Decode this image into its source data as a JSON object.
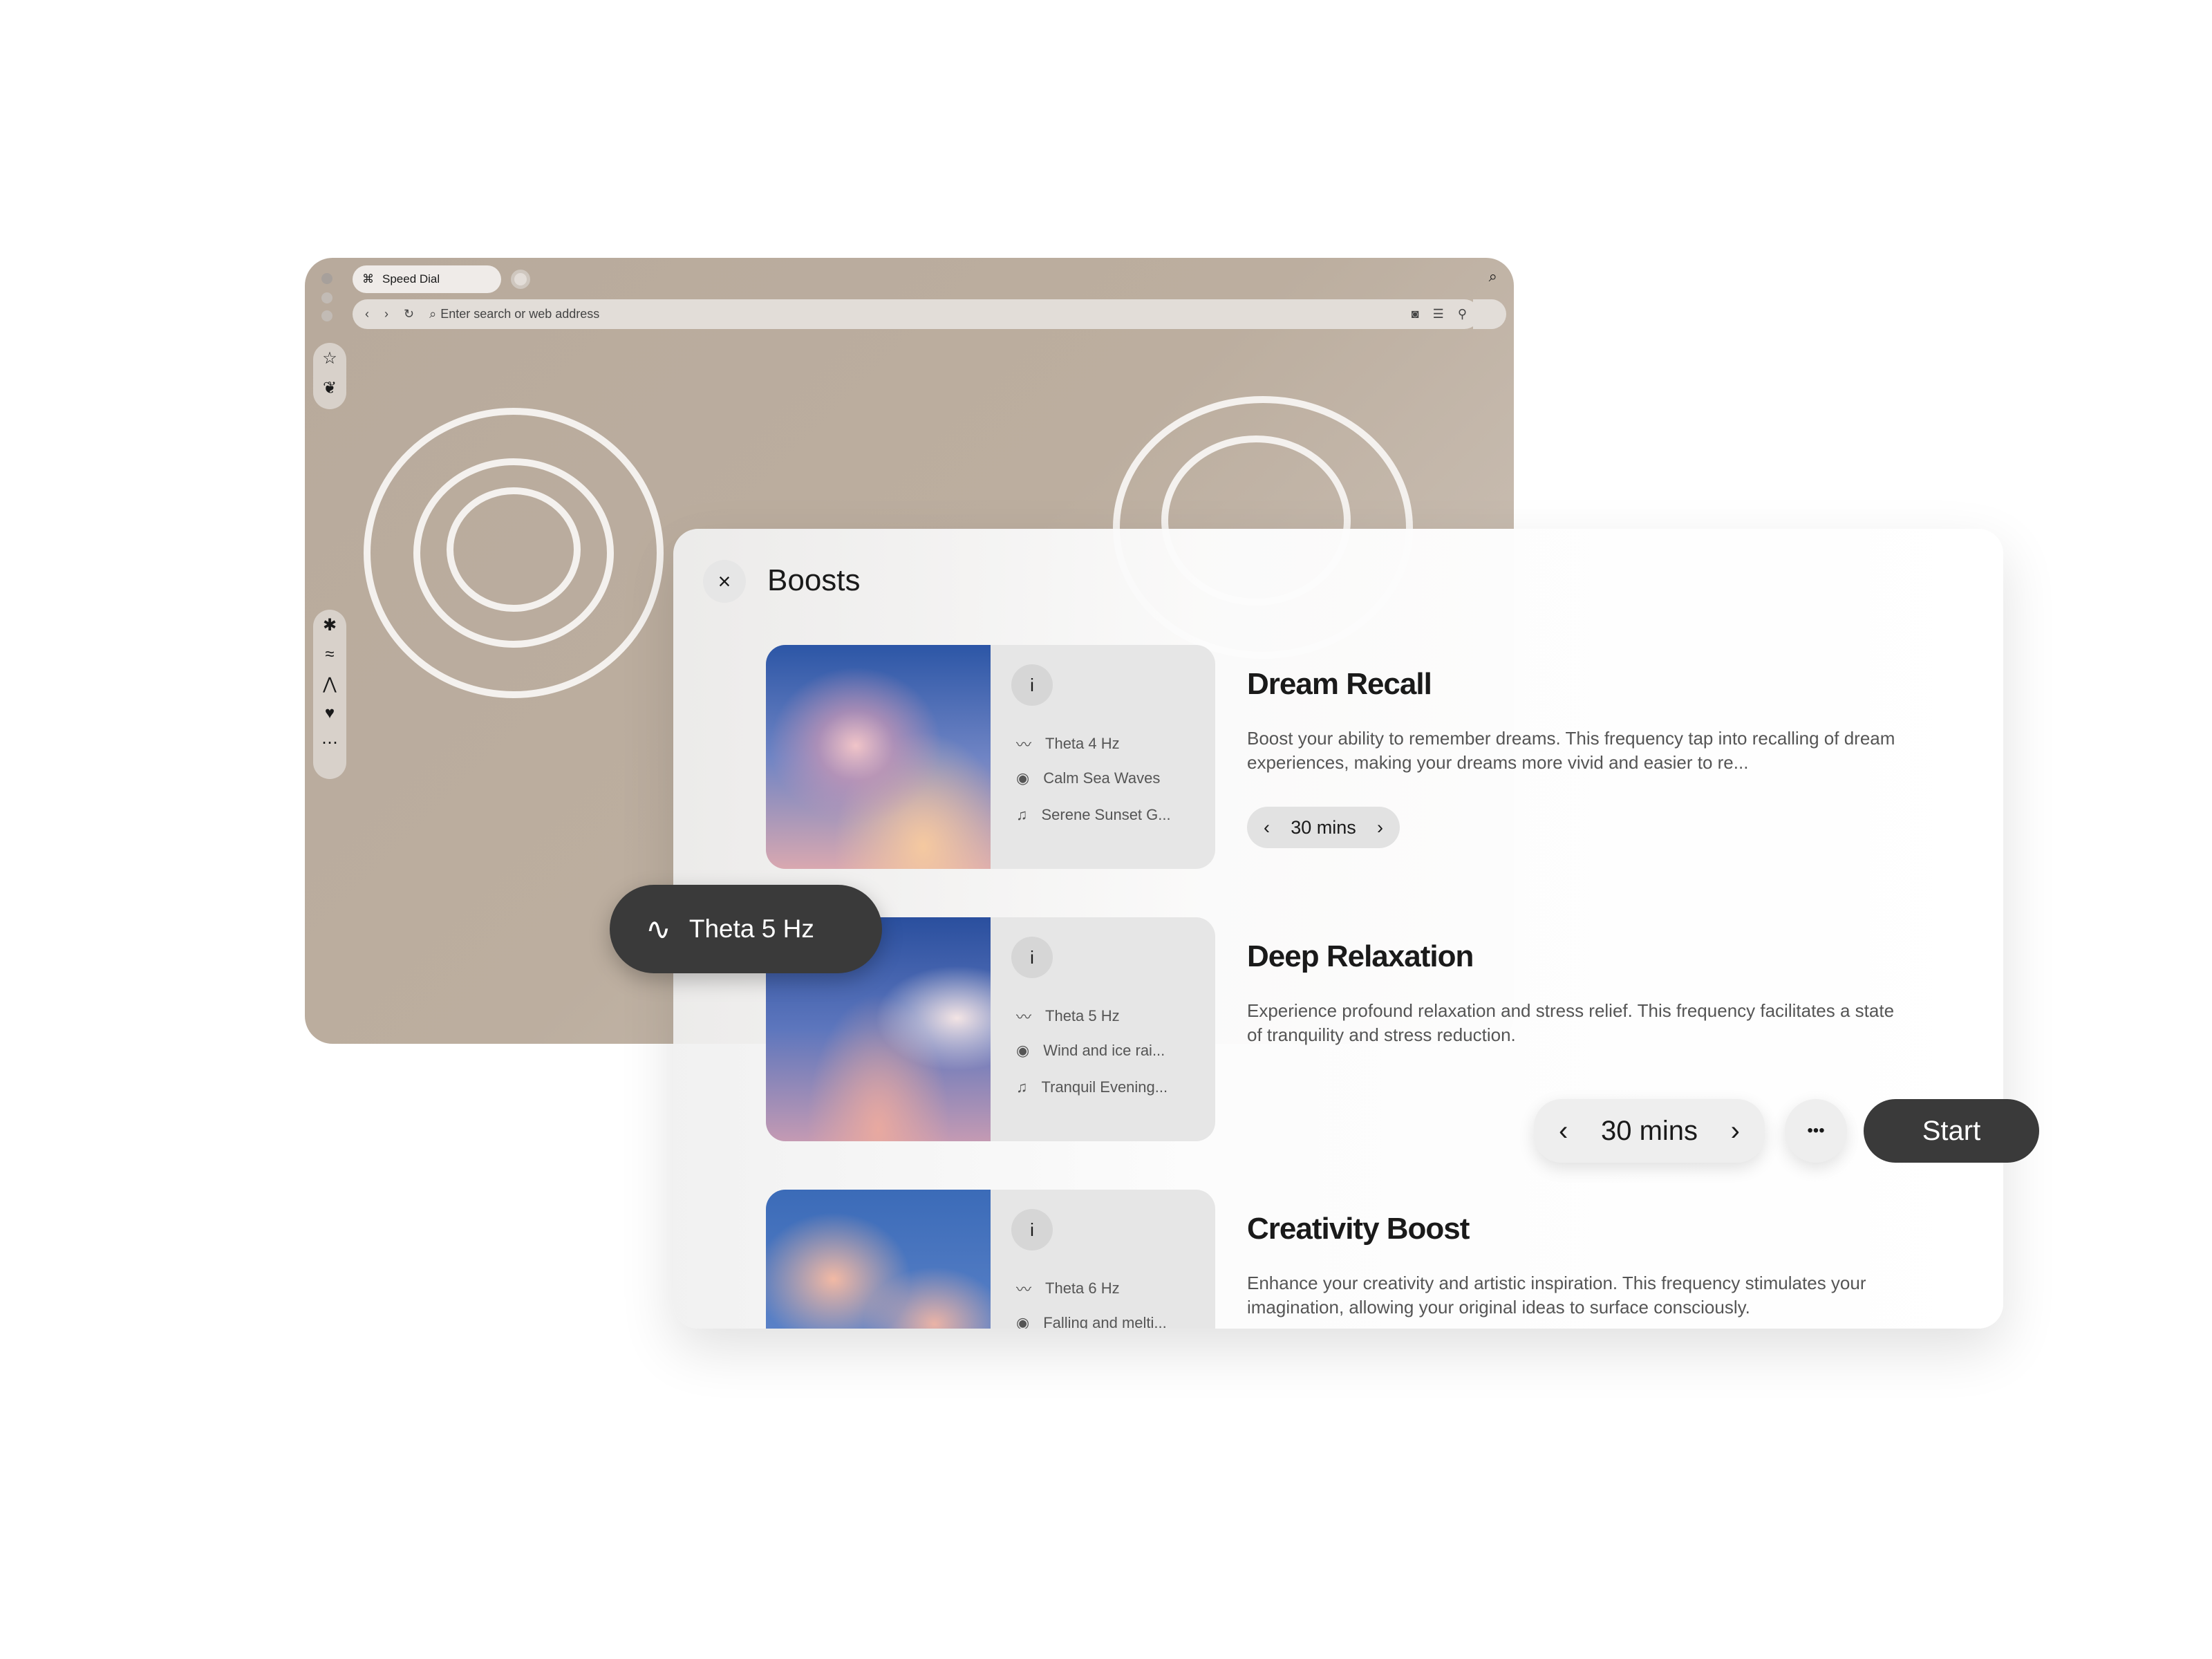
{
  "browser": {
    "tab_label": "Speed Dial",
    "address_placeholder": "Enter search or web address",
    "sidebar_top": [
      "star-icon",
      "leaf-icon"
    ],
    "sidebar_bottom": [
      "asterisk-icon",
      "wave-lines-icon",
      "mountain-icon",
      "heart-icon",
      "more-icon"
    ]
  },
  "panel": {
    "title": "Boosts",
    "cards": [
      {
        "title": "Dream Recall",
        "description": "Boost your ability to remember dreams. This frequency tap into recalling of dream experiences, making your dreams more vivid and easier to re...",
        "frequency": "Theta 4 Hz",
        "ambience": "Calm Sea Waves",
        "music": "Serene Sunset G...",
        "duration": "30 mins"
      },
      {
        "title": "Deep Relaxation",
        "description": "Experience profound relaxation and stress relief. This frequency facilitates a state of tranquility and stress reduction.",
        "frequency": "Theta 5 Hz",
        "ambience": "Wind and ice rai...",
        "music": "Tranquil Evening...",
        "duration": "30 mins"
      },
      {
        "title": "Creativity Boost",
        "description": "Enhance your creativity and artistic inspiration. This frequency stimulates your imagination, allowing your original ideas to surface consciously.",
        "frequency": "Theta 6 Hz",
        "ambience": "Falling and melti..."
      }
    ],
    "info_label": "i"
  },
  "tooltip": {
    "label": "Theta 5 Hz"
  },
  "controls": {
    "duration": "30 mins",
    "more": "•••",
    "start": "Start"
  },
  "colors": {
    "dark": "#3a3a3a",
    "browser_bg": "#bcae9f"
  }
}
